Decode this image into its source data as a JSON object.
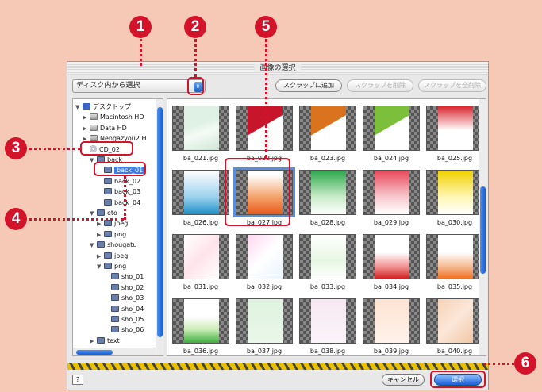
{
  "window": {
    "title": "画像の選択",
    "source_popup": "ディスク内から選択",
    "buttons": {
      "add": "スクラップに追加",
      "remove": "スクラップを削除",
      "remove_all": "スクラップを全削除"
    },
    "cancel": "キャンセル",
    "select": "選択",
    "help": "?"
  },
  "callouts": [
    "1",
    "2",
    "3",
    "4",
    "5",
    "6"
  ],
  "tree": [
    {
      "label": "デスクトップ",
      "icon": "desktop-icon"
    },
    {
      "label": "Macintosh HD",
      "icon": "hard-drive-icon"
    },
    {
      "label": "Data HD",
      "icon": "hard-drive-icon"
    },
    {
      "label": "Nengazyou2   H",
      "icon": "hard-drive-icon"
    },
    {
      "label": "CD_02",
      "icon": "cd-icon"
    },
    {
      "label": "back",
      "icon": "folder-icon"
    },
    {
      "label": "back_01",
      "icon": "folder-icon"
    },
    {
      "label": "back_02",
      "icon": "folder-icon"
    },
    {
      "label": "back_03",
      "icon": "folder-icon"
    },
    {
      "label": "back_04",
      "icon": "folder-icon"
    },
    {
      "label": "eto",
      "icon": "folder-icon"
    },
    {
      "label": "jpeg",
      "icon": "folder-icon"
    },
    {
      "label": "png",
      "icon": "folder-icon"
    },
    {
      "label": "shougatu",
      "icon": "folder-icon"
    },
    {
      "label": "jpeg",
      "icon": "folder-icon"
    },
    {
      "label": "png",
      "icon": "folder-icon"
    },
    {
      "label": "sho_01",
      "icon": "folder-icon"
    },
    {
      "label": "sho_02",
      "icon": "folder-icon"
    },
    {
      "label": "sho_03",
      "icon": "folder-icon"
    },
    {
      "label": "sho_04",
      "icon": "folder-icon"
    },
    {
      "label": "sho_05",
      "icon": "folder-icon"
    },
    {
      "label": "sho_06",
      "icon": "folder-icon"
    },
    {
      "label": "text",
      "icon": "folder-icon"
    }
  ],
  "files": [
    "ba_021.jpg",
    "ba_022.jpg",
    "ba_023.jpg",
    "ba_024.jpg",
    "ba_025.jpg",
    "ba_026.jpg",
    "ba_027.jpg",
    "ba_028.jpg",
    "ba_029.jpg",
    "ba_030.jpg",
    "ba_031.jpg",
    "ba_032.jpg",
    "ba_033.jpg",
    "ba_034.jpg",
    "ba_035.jpg",
    "ba_036.jpg",
    "ba_037.jpg",
    "ba_038.jpg",
    "ba_039.jpg",
    "ba_040.jpg"
  ],
  "thumb_styles": [
    "linear-gradient(160deg,#dff0e4 40%,#f4fbf6 60%,#cfe6d6)",
    "linear-gradient(150deg,#c7162b 45%,#fff 46%)",
    "linear-gradient(150deg,#d9731e 45%,#fff 46%)",
    "linear-gradient(150deg,#7cbf3a 45%,#fff 46%)",
    "linear-gradient(#d8262e,#fff 55%,#fff)",
    "linear-gradient(#fff,#9dd2ee 60%,#1e90c8)",
    "linear-gradient(#fff 10%,#f4a36c 60%,#e85a1c)",
    "linear-gradient(#2aa84a,#c9ecc9 60%,#fff)",
    "linear-gradient(#e8485a,#f8c9cf 60%,#fff)",
    "linear-gradient(#f0d000,#fff7b3 60%,#fff)",
    "linear-gradient(135deg,#fff,#ffe3ea 50%,#fff)",
    "linear-gradient(135deg,#ffd8f0,#fff 50%,#e9f4ff)",
    "linear-gradient(#fff,#e7f7e3 60%,#fff)",
    "linear-gradient(#fff 40%,#f08a8a 75%,#d02020)",
    "linear-gradient(#fff 40%,#f5b58a 75%,#f07020)",
    "linear-gradient(#fff 40%,#c9ecb5 70%,#3cae3c)",
    "linear-gradient(#dff2df,#eaf7ea)",
    "linear-gradient(#f6e8f2,#fbf4f9)",
    "linear-gradient(#fde3d2,#fff2ea)",
    "linear-gradient(135deg,#f7d3b8,#fbe7d8 50%,#f2c6a4)"
  ]
}
